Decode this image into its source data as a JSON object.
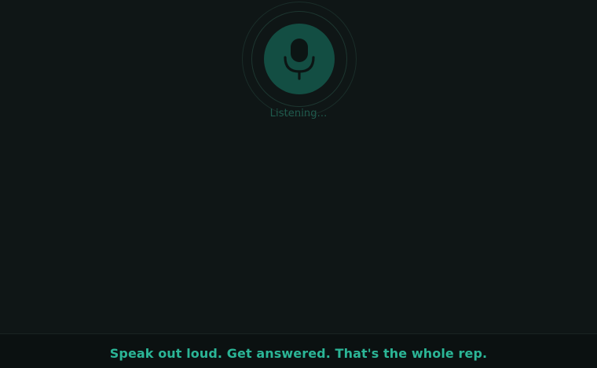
{
  "voice": {
    "status_text": "Listening...",
    "icon": "microphone-icon",
    "accent_color": "#134e43"
  },
  "footer": {
    "tagline": "Speak out loud. Get answered. That's the whole rep.",
    "text_color": "#2bb596"
  }
}
